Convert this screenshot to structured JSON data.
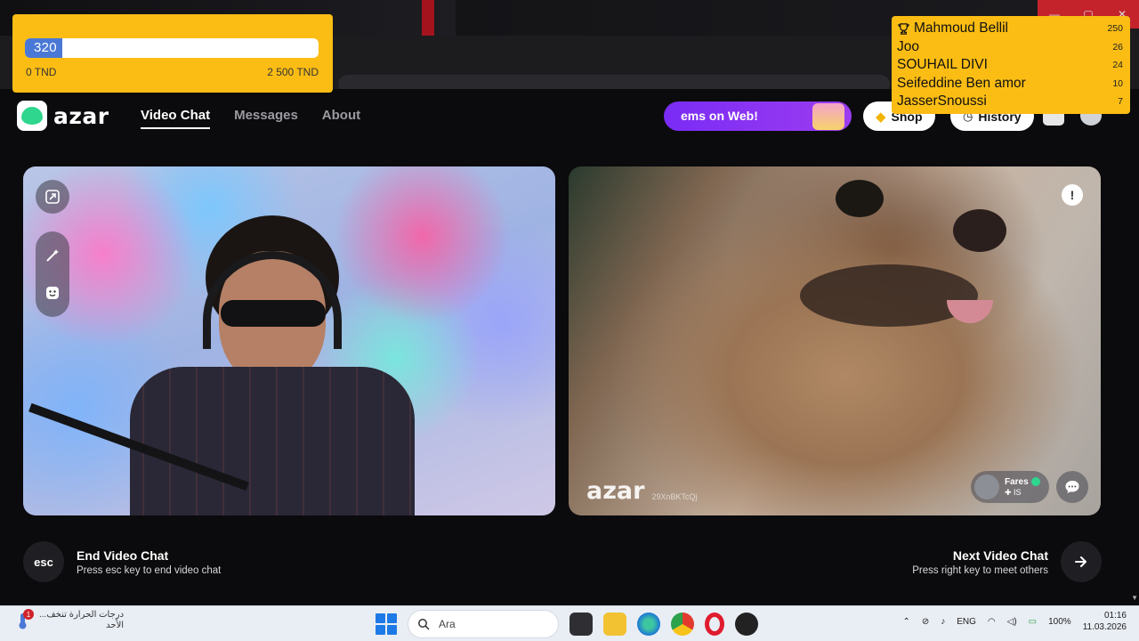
{
  "window": {
    "minimize": "—",
    "maximize": "▢",
    "close": "✕"
  },
  "goal": {
    "current": "320",
    "progress_fraction": 0.128,
    "min_label": "0 TND",
    "max_label": "2 500 TND",
    "fill_color": "#4a78d6",
    "background": "#fbbd14"
  },
  "leaderboard": [
    {
      "name": "Mahmoud Bellil",
      "score": "250",
      "icon": "trophy-icon"
    },
    {
      "name": "Joo",
      "score": "26"
    },
    {
      "name": "SOUHAIL DIVI",
      "score": "24"
    },
    {
      "name": "Seifeddine Ben amor",
      "score": "10"
    },
    {
      "name": "JasserSnoussi",
      "score": "7"
    }
  ],
  "app": {
    "logo_text": "azar",
    "brand_color": "#2fd68e",
    "nav": [
      {
        "label": "Video Chat",
        "active": true
      },
      {
        "label": "Messages",
        "active": false
      },
      {
        "label": "About",
        "active": false
      }
    ],
    "promo_text": "ems on Web!",
    "shop_label": "Shop",
    "history_label": "History"
  },
  "video": {
    "watermark": "azar",
    "session_id": "29XnBKTcQj",
    "peer_name": "Fares",
    "peer_country": "IS",
    "report_symbol": "!"
  },
  "controls": {
    "end_key": "esc",
    "end_title": "End Video Chat",
    "end_sub": "Press esc key to end video chat",
    "next_title": "Next Video Chat",
    "next_sub": "Press right key to meet others"
  },
  "taskbar": {
    "weather_line1": "درجات الحرارة تنخف...",
    "weather_line2": "الأحد",
    "notification_count": "1",
    "search_placeholder": "Ara",
    "language": "ENG",
    "battery": "100%",
    "time": "01:16",
    "date": "11.03.2026"
  }
}
